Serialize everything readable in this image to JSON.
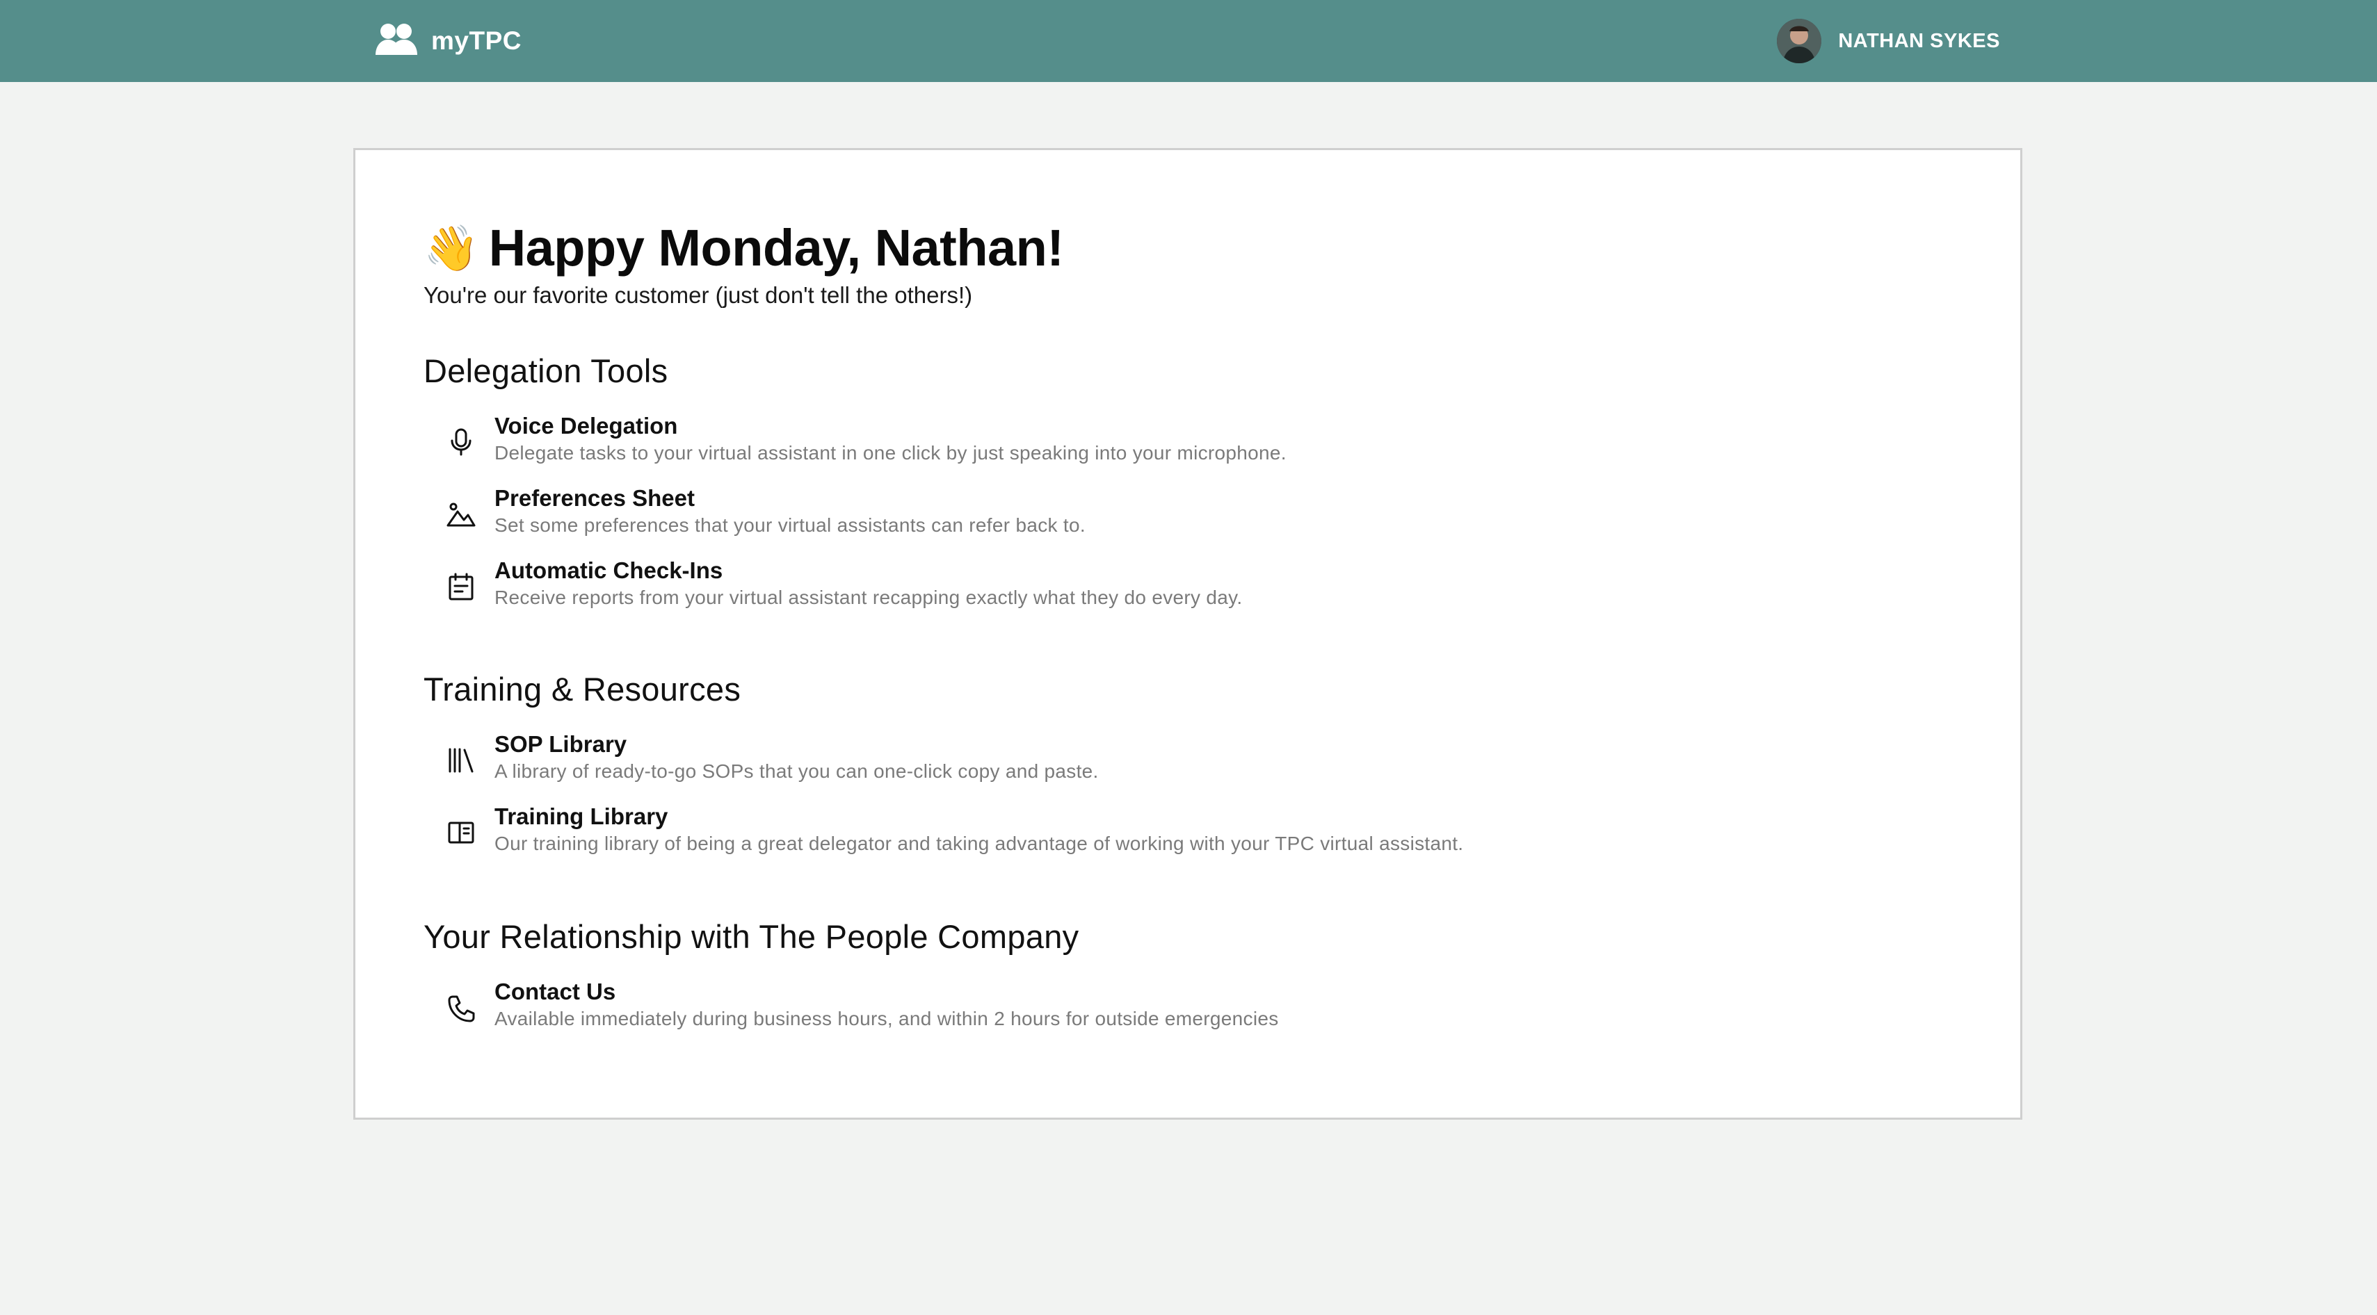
{
  "header": {
    "app_name": "myTPC",
    "user_name": "NATHAN SYKES",
    "brand_color": "#558e8b",
    "logo_icon": "users-icon"
  },
  "hero": {
    "emoji": "👋",
    "greeting": "Happy Monday, Nathan!",
    "subtitle": "You're our favorite customer (just don't tell the others!)"
  },
  "sections": [
    {
      "title": "Delegation Tools",
      "items": [
        {
          "icon": "microphone-icon",
          "title": "Voice Delegation",
          "description": "Delegate tasks to your virtual assistant in one click by just speaking into your microphone."
        },
        {
          "icon": "landscape-icon",
          "title": "Preferences Sheet",
          "description": "Set some preferences that your virtual assistants can refer back to."
        },
        {
          "icon": "calendar-report-icon",
          "title": "Automatic Check-Ins",
          "description": "Receive reports from your virtual assistant recapping exactly what they do every day."
        }
      ]
    },
    {
      "title": "Training & Resources",
      "items": [
        {
          "icon": "library-icon",
          "title": "SOP Library",
          "description": "A library of ready-to-go SOPs that you can one-click copy and paste."
        },
        {
          "icon": "book-layout-icon",
          "title": "Training Library",
          "description": "Our training library of being a great delegator and taking advantage of working with your TPC virtual assistant."
        }
      ]
    },
    {
      "title": "Your Relationship with The People Company",
      "items": [
        {
          "icon": "phone-icon",
          "title": "Contact Us",
          "description": "Available immediately during business hours, and within 2 hours for outside emergencies"
        }
      ]
    }
  ]
}
